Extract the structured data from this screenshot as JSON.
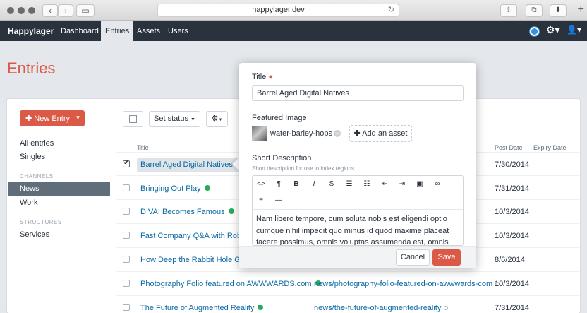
{
  "browser": {
    "url": "happylager.dev",
    "icons": [
      "back-icon",
      "forward-icon",
      "sidebar-icon",
      "reload-icon",
      "share-icon",
      "tabs-icon",
      "download-icon",
      "new-tab-icon"
    ]
  },
  "nav": {
    "brand": "Happylager",
    "links": [
      "Dashboard",
      "Entries",
      "Assets",
      "Users"
    ],
    "active": "Entries"
  },
  "page": {
    "title": "Entries"
  },
  "sidebar": {
    "new_entry": "New Entry",
    "items": [
      "All entries",
      "Singles"
    ],
    "channels_heading": "CHANNELS",
    "channels": [
      "News",
      "Work"
    ],
    "selected": "News",
    "structures_heading": "STRUCTURES",
    "structures": [
      "Services"
    ]
  },
  "toolbar": {
    "set_status": "Set status"
  },
  "table": {
    "headers": {
      "title": "Title",
      "post_date": "Post Date",
      "expiry_date": "Expiry Date"
    },
    "rows": [
      {
        "title": "Barrel Aged Digital Natives",
        "uri": "",
        "post_date": "7/30/2014",
        "checked": true
      },
      {
        "title": "Bringing Out Play",
        "uri": "",
        "post_date": "7/31/2014",
        "checked": false
      },
      {
        "title": "DIVA! Becomes Famous",
        "uri": "",
        "post_date": "10/3/2014",
        "checked": false
      },
      {
        "title": "Fast Company Q&A with Robin F",
        "uri": "",
        "post_date": "10/3/2014",
        "checked": false
      },
      {
        "title": "How Deep the Rabbit Hole Goes",
        "uri": "",
        "post_date": "8/6/2014",
        "checked": false
      },
      {
        "title": "Photography Folio featured on AWWWARDS.com",
        "uri": "news/photography-folio-featured-on-awwwards-com",
        "post_date": "10/3/2014",
        "checked": false
      },
      {
        "title": "The Future of Augmented Reality",
        "uri": "news/the-future-of-augmented-reality",
        "post_date": "7/31/2014",
        "checked": false
      }
    ],
    "status_color": "#27ab5a"
  },
  "hud": {
    "title_label": "Title",
    "title_value": "Barrel Aged Digital Natives",
    "featured_label": "Featured Image",
    "asset_name": "water-barley-hops",
    "add_asset": "Add an asset",
    "short_desc_label": "Short Description",
    "short_desc_hint": "Short description for use in index regions.",
    "toolbar_icons": [
      "code-icon",
      "paragraph-icon",
      "bold-icon",
      "italic-icon",
      "strikethrough-icon",
      "bullet-list-icon",
      "numbered-list-icon",
      "outdent-icon",
      "indent-icon",
      "image-icon",
      "link-icon",
      "align-icon",
      "horizontal-rule-icon"
    ],
    "body_text": "Nam libero tempore, cum soluta nobis est eligendi optio cumque nihil impedit quo minus id quod maxime placeat facere possimus, omnis voluptas assumenda est, omnis dolor repellendus.",
    "cancel": "Cancel",
    "save": "Save"
  },
  "colors": {
    "accent": "#da5a47",
    "nav_bg": "#29323d",
    "link": "#0b69a3"
  }
}
